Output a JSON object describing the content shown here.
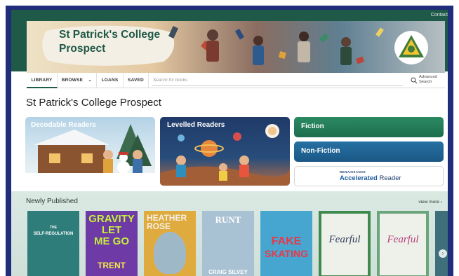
{
  "topbar": {
    "contact": "Contact"
  },
  "banner": {
    "title": "St Patrick's College Prospect"
  },
  "nav": {
    "library": "LIBRARY",
    "browse": "BROWSE",
    "loans": "LOANS",
    "saved": "SAVED",
    "search_placeholder": "Search for books",
    "advanced_search": "Advanced Search"
  },
  "main": {
    "heading": "St Patrick's College Prospect"
  },
  "tiles": {
    "decodable": "Decodable Readers",
    "levelled": "Levelled Readers",
    "fiction": "Fiction",
    "nonfiction": "Non-Fiction",
    "ar_small": "RENAISSANCE",
    "ar_accel": "Accelerated",
    "ar_reader": "Reader"
  },
  "newly_published": {
    "title": "Newly Published",
    "view_more": "view more",
    "books": [
      {
        "lines": [
          "THE",
          "SELF-REGULATION"
        ],
        "color": "#2f7d7a"
      },
      {
        "lines": [
          "GRAVITY",
          "LET",
          "ME GO",
          "TRENT"
        ],
        "color": "#6d3aa6"
      },
      {
        "lines": [
          "HEATHER",
          "ROSE"
        ],
        "color": "#e0ab3e"
      },
      {
        "lines": [
          "RUNT",
          "CRAIG SILVEY"
        ],
        "color": "#a9c2d3"
      },
      {
        "lines": [
          "FAKE",
          "SKATING"
        ],
        "color": "#46a6cf"
      },
      {
        "lines": [
          "Fearful"
        ],
        "color": "#eef1ea"
      },
      {
        "lines": [
          "Fearful"
        ],
        "color": "#eef1ea"
      }
    ]
  },
  "colors": {
    "brand_green": "#1f5948",
    "frame_blue": "#1f2d7a"
  }
}
